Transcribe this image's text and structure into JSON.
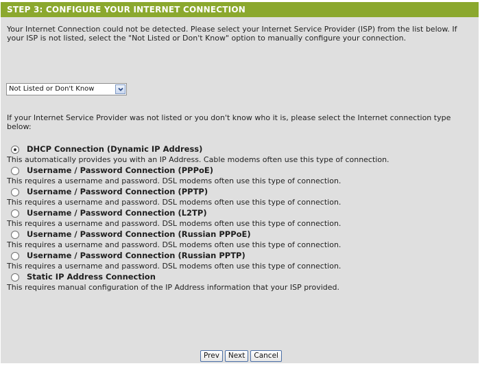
{
  "header": {
    "title": "STEP 3: CONFIGURE YOUR INTERNET CONNECTION"
  },
  "intro": {
    "text": "Your Internet Connection could not be detected. Please select your Internet Service Provider (ISP) from the list below. If your ISP is not listed, select the \"Not Listed or Don't Know\" option to manually configure your connection."
  },
  "isp_select": {
    "selected": "Not Listed or Don't Know",
    "icon": "chevron-down-icon"
  },
  "connection_info": {
    "text": "If your Internet Service Provider was not listed or you don't know who it is, please select the Internet connection type below:"
  },
  "options": [
    {
      "label": "DHCP Connection (Dynamic IP Address)",
      "description": "This automatically provides you with an IP Address. Cable modems often use this type of connection.",
      "checked": true
    },
    {
      "label": "Username / Password Connection (PPPoE)",
      "description": "This requires a username and password. DSL modems often use this type of connection.",
      "checked": false
    },
    {
      "label": "Username / Password Connection (PPTP)",
      "description": "This requires a username and password. DSL modems often use this type of connection.",
      "checked": false
    },
    {
      "label": "Username / Password Connection (L2TP)",
      "description": "This requires a username and password. DSL modems often use this type of connection.",
      "checked": false
    },
    {
      "label": "Username / Password Connection (Russian PPPoE)",
      "description": "This requires a username and password. DSL modems often use this type of connection.",
      "checked": false
    },
    {
      "label": "Username / Password Connection (Russian PPTP)",
      "description": "This requires a username and password. DSL modems often use this type of connection.",
      "checked": false
    },
    {
      "label": "Static IP Address Connection",
      "description": "This requires manual configuration of the IP Address information that your ISP provided.",
      "checked": false
    }
  ],
  "buttons": {
    "prev": "Prev",
    "next": "Next",
    "cancel": "Cancel"
  },
  "colors": {
    "header_bg": "#8ba82e",
    "panel_bg": "#dfdfdf"
  }
}
